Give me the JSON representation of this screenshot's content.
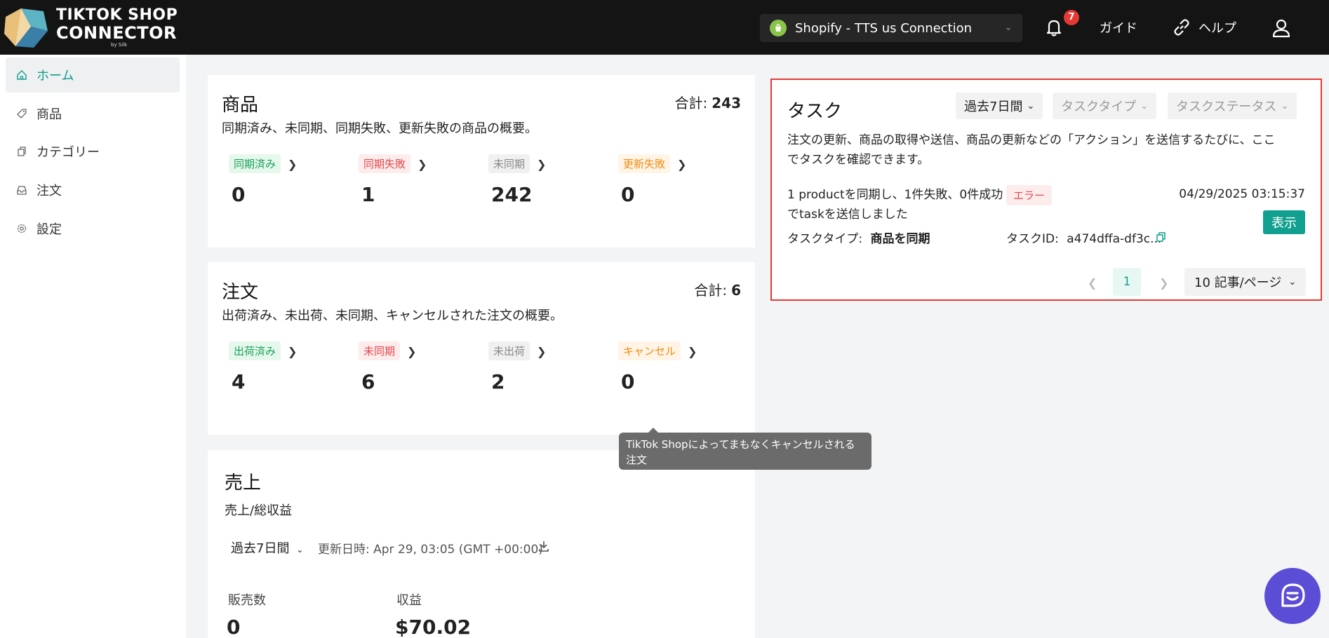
{
  "brand": {
    "line1": "TIKTOK SHOP",
    "line2": "CONNECTOR",
    "line3": "by Silk"
  },
  "topbar": {
    "store": "Shopify - TTS us Connection",
    "notifications": "7",
    "guide": "ガイド",
    "help": "ヘルプ"
  },
  "sidebar": {
    "items": [
      {
        "label": "ホーム",
        "icon": "home-icon",
        "active": true
      },
      {
        "label": "商品",
        "icon": "tag-icon"
      },
      {
        "label": "カテゴリー",
        "icon": "copy-icon"
      },
      {
        "label": "注文",
        "icon": "inbox-icon"
      },
      {
        "label": "設定",
        "icon": "gear-icon"
      }
    ]
  },
  "products": {
    "title": "商品",
    "desc": "同期済み、未同期、同期失敗、更新失敗の商品の概要。",
    "total_label": "合計:",
    "total": "243",
    "stats": [
      {
        "label": "同期済み",
        "value": "0"
      },
      {
        "label": "同期失敗",
        "value": "1"
      },
      {
        "label": "未同期",
        "value": "242"
      },
      {
        "label": "更新失敗",
        "value": "0"
      }
    ]
  },
  "orders": {
    "title": "注文",
    "desc": "出荷済み、未出荷、未同期、キャンセルされた注文の概要。",
    "total_label": "合計:",
    "total": "6",
    "stats": [
      {
        "label": "出荷済み",
        "value": "4"
      },
      {
        "label": "未同期",
        "value": "6"
      },
      {
        "label": "未出荷",
        "value": "2"
      },
      {
        "label": "キャンセル",
        "value": "0"
      }
    ]
  },
  "tooltip": "TikTok Shopによってまもなくキャンセルされる注文",
  "sales": {
    "title": "売上",
    "subtitle": "売上/総収益",
    "period": "過去7日間",
    "updated": "更新日時:  Apr 29, 03:05 (GMT +00:00)",
    "units_label": "販売数",
    "units": "0",
    "revenue_label": "収益",
    "revenue": "$70.02"
  },
  "tasks": {
    "title": "タスク",
    "filters": {
      "period": "過去7日間",
      "type": "タスクタイプ",
      "status": "タスクステータス"
    },
    "desc_line1": "注文の更新、商品の取得や送信、商品の更新などの「アクション」を送信するたびに、ここ",
    "desc_line2": "でタスクを確認できます。",
    "item": {
      "line1": "1 productを同期し、1件失敗、0件成功",
      "line2": "でtaskを送信しました",
      "status": "エラー",
      "time": "04/29/2025 03:15:37",
      "type_label": "タスクタイプ:",
      "type_value": "商品を同期",
      "id_label": "タスクID:",
      "id_value": "a474dffa-df3c...",
      "view": "表示"
    },
    "pager": {
      "page": "1",
      "page_size": "10 記事/ページ"
    }
  },
  "colors": {
    "accent": "#11a08f",
    "highlight_border": "#e53935",
    "topbar": "#141414",
    "chat": "#5b4dd6"
  }
}
